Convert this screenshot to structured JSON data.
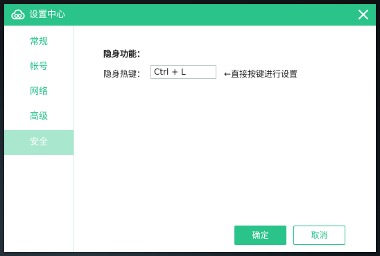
{
  "window": {
    "title": "设置中心",
    "logo_icon": "cloud-logo-icon",
    "close_icon": "close-icon"
  },
  "sidebar": {
    "items": [
      {
        "label": "常规",
        "active": false
      },
      {
        "label": "帐号",
        "active": false
      },
      {
        "label": "网络",
        "active": false
      },
      {
        "label": "高级",
        "active": false
      },
      {
        "label": "安全",
        "active": true
      }
    ]
  },
  "content": {
    "section_title": "隐身功能：",
    "hotkey_label": "隐身热键：",
    "hotkey_value": "Ctrl + L",
    "hotkey_hint": "←直接按键进行设置"
  },
  "footer": {
    "ok_label": "确定",
    "cancel_label": "取消"
  },
  "colors": {
    "accent": "#2ac38a",
    "active_item_bg": "#a9e8ce"
  }
}
